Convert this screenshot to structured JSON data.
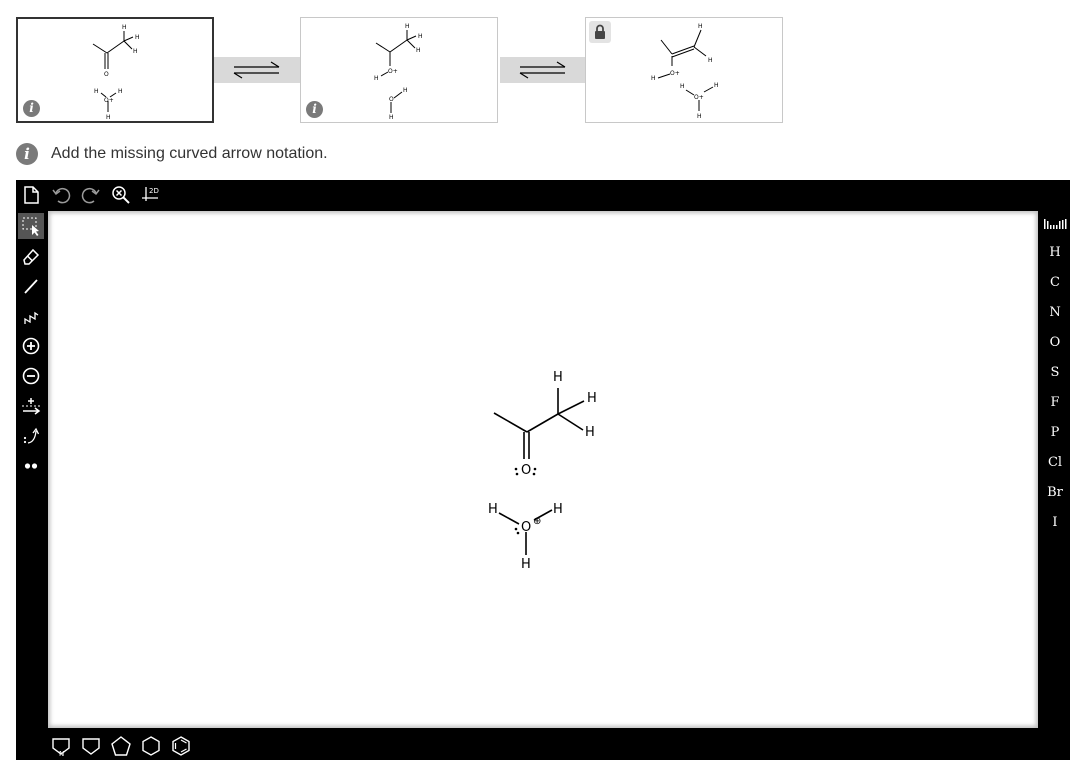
{
  "steps": [
    {
      "info_icon": "info-icon",
      "locked": false,
      "active": true
    },
    {
      "info_icon": "info-icon",
      "locked": false,
      "active": false
    },
    {
      "lock_icon": "lock-icon",
      "locked": true,
      "active": false
    }
  ],
  "atoms": {
    "H": "H",
    "O": "O",
    "O_plus": "O+",
    "charge_plus": "⊕",
    "lone_pair": ":"
  },
  "instruction": {
    "icon": "info-icon",
    "text": "Add the missing curved arrow notation."
  },
  "top_toolbar": {
    "icons": [
      "new-document-icon",
      "undo-icon",
      "redo-icon",
      "zoom-clear-icon",
      "clean-2d-icon"
    ],
    "clean_label": "2D"
  },
  "left_toolbar": {
    "icons": [
      "select-icon",
      "eraser-icon",
      "single-bond-icon",
      "chain-icon",
      "positive-charge-icon",
      "negative-charge-icon",
      "reaction-arrow-icon",
      "curved-arrow-icon",
      "lone-pair-icon"
    ],
    "selected": "select-icon"
  },
  "right_toolbar": {
    "periodic_icon": "periodic-table-icon",
    "elements": [
      "H",
      "C",
      "N",
      "O",
      "S",
      "F",
      "P",
      "Cl",
      "Br",
      "I"
    ]
  },
  "bottom_toolbar": {
    "icons": [
      "benzene-n-icon",
      "cyclobutane-icon",
      "cyclopentane-icon",
      "cyclohexane-icon",
      "benzene-icon"
    ],
    "n_label": "N"
  }
}
